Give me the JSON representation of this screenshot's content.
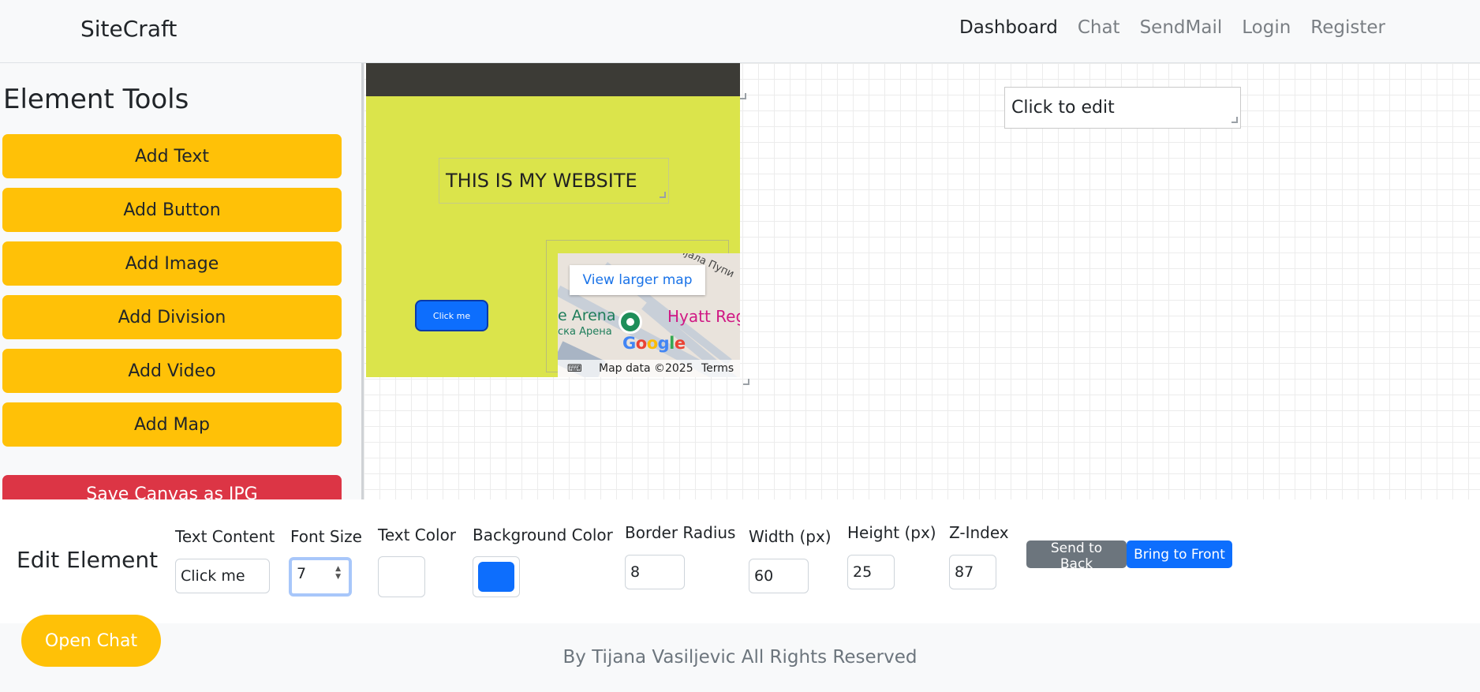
{
  "navbar": {
    "brand": "SiteCraft",
    "links": [
      {
        "label": "Dashboard",
        "active": true
      },
      {
        "label": "Chat",
        "active": false
      },
      {
        "label": "SendMail",
        "active": false
      },
      {
        "label": "Login",
        "active": false
      },
      {
        "label": "Register",
        "active": false
      }
    ]
  },
  "sidebar": {
    "title": "Element Tools",
    "tools": [
      "Add Text",
      "Add Button",
      "Add Image",
      "Add Division",
      "Add Video",
      "Add Map"
    ],
    "save_label": "Save Canvas as JPG"
  },
  "canvas": {
    "heading_text": "THIS IS MY WEBSITE",
    "button_text": "Click me",
    "text_box": "Click to edit",
    "map": {
      "view_larger": "View larger map",
      "arena": "e Arena",
      "arena_cyrillic": "ска Арена",
      "hotel": "Hyatt Regency",
      "google": "Google",
      "street": "Иjaла Пупи",
      "map_data": "Map data ©2025",
      "terms": "Terms"
    },
    "colors": {
      "division_bg": "#dbe44b",
      "division_bar": "#3c3b36",
      "button_bg": "#0d6efd"
    }
  },
  "edit": {
    "title": "Edit Element",
    "labels": {
      "text_content": "Text Content",
      "font_size": "Font Size",
      "text_color": "Text Color",
      "background_color": "Background Color",
      "border_radius": "Border Radius",
      "width": "Width (px)",
      "height": "Height (px)",
      "z_index": "Z-Index"
    },
    "values": {
      "text_content": "Click me",
      "font_size": "7",
      "text_color": "#ffffff",
      "background_color": "#0d6efd",
      "border_radius": "8",
      "width": "60",
      "height": "25",
      "z_index": "87"
    },
    "send_back": "Send to Back",
    "bring_front": "Bring to Front"
  },
  "footer": {
    "text": "By Tijana Vasiljevic All Rights Reserved",
    "chat_button": "Open Chat"
  },
  "colors": {
    "accent": "#ffc107",
    "danger": "#dc3545",
    "primary": "#0d6efd",
    "secondary": "#6c757d"
  }
}
